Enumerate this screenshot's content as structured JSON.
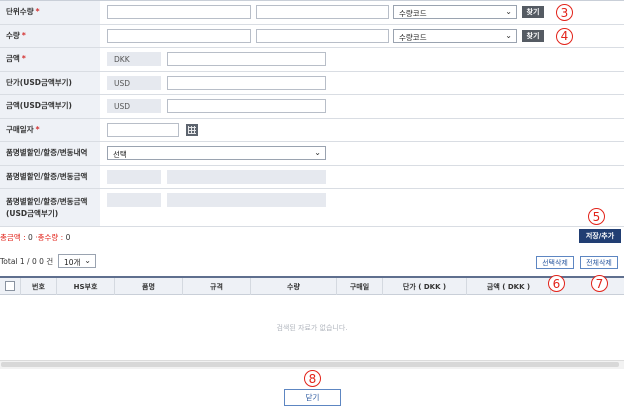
{
  "form": {
    "unit_qty_label": "단위수량",
    "qty_label": "수량",
    "amount_label": "금액",
    "unit_price_usd_label": "단가(USD금액부기)",
    "amount_usd_label": "금액(USD금액부기)",
    "purchase_date_label": "구매일자",
    "item_discount_label": "품명별할인/할증/변동내역",
    "item_discount_amount_label": "품명별할인/할증/변동금액",
    "item_discount_usd_label_line1": "품명별할인/할증/변동금액",
    "item_discount_usd_label_line2": "(USD금액부기)",
    "required_mark": "*",
    "unit_code_select": "수량코드",
    "qty_code_select": "수량코드",
    "find_label": "찾기",
    "currency_dkk": "DKK",
    "currency_usd": "USD",
    "discount_select": "선택"
  },
  "markers": {
    "m3": "3",
    "m4": "4",
    "m5": "5",
    "m6": "6",
    "m7": "7",
    "m8": "8"
  },
  "summary": {
    "total_amount_label": "총금액 :",
    "total_amount_value": "0",
    "separator": "·",
    "total_qty_label": "총수량 :",
    "total_qty_value": "0"
  },
  "save_add_label": "저장/추가",
  "pagination": {
    "total_text": "Total 1 / 0  0 건",
    "page_size": "10개"
  },
  "actions": {
    "delete_selected": "선택삭제",
    "delete_all": "전체삭제"
  },
  "grid": {
    "columns": [
      "번호",
      "HS부호",
      "품명",
      "규격",
      "수량",
      "구매일",
      "단가 ( DKK )",
      "금액 ( DKK )"
    ],
    "empty_message": "검색된 자료가 없습니다."
  },
  "close_label": "닫기",
  "colors": {
    "accent_red": "#e2231a",
    "navy": "#213e73",
    "header_bg": "#eef1f6"
  }
}
